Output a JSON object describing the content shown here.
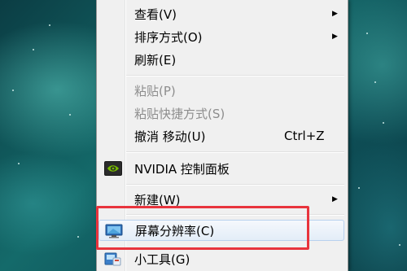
{
  "menu": {
    "items": [
      {
        "label": "查看(V)"
      },
      {
        "label": "排序方式(O)"
      },
      {
        "label": "刷新(E)"
      },
      {
        "label": "粘贴(P)"
      },
      {
        "label": "粘贴快捷方式(S)"
      },
      {
        "label": "撤消 移动(U)",
        "shortcut": "Ctrl+Z"
      },
      {
        "label": "NVIDIA 控制面板"
      },
      {
        "label": "新建(W)"
      },
      {
        "label": "屏幕分辨率(C)"
      },
      {
        "label": "小工具(G)"
      }
    ]
  },
  "colors": {
    "highlight_box": "#e8343d",
    "menu_background": "#f0f0f0",
    "disabled_text": "#8d8d8d"
  },
  "icons": {
    "nvidia": "nvidia-icon",
    "display": "monitor-icon",
    "gadgets": "gadgets-icon",
    "submenu": "submenu-arrow-icon"
  }
}
